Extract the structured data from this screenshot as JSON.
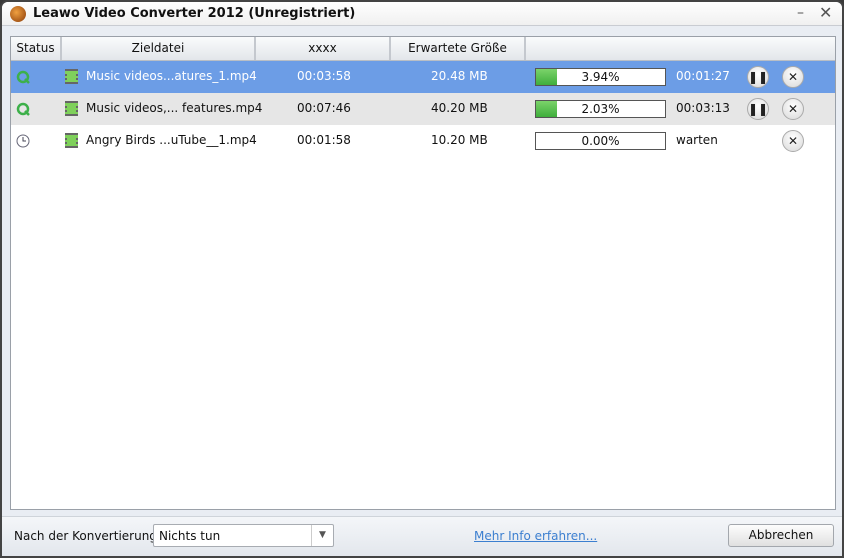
{
  "window": {
    "title": "Leawo Video Converter 2012 (Unregistriert)",
    "minimize": "–",
    "close": "✕"
  },
  "columns": [
    "Status",
    "Zieldatei",
    "xxxx",
    "Erwartete Größe",
    ""
  ],
  "rows": [
    {
      "status": "converting",
      "file": "Music videos...atures_1.mp4",
      "duration": "00:03:58",
      "size": "20.48 MB",
      "progress": 3.94,
      "progress_label": "3.94%",
      "remaining": "00:01:27",
      "pause": "❚❚",
      "cancel": "✕"
    },
    {
      "status": "converting",
      "file": "Music videos,... features.mp4",
      "duration": "00:07:46",
      "size": "40.20 MB",
      "progress": 2.03,
      "progress_label": "2.03%",
      "remaining": "00:03:13",
      "pause": "❚❚",
      "cancel": "✕"
    },
    {
      "status": "waiting",
      "file": "Angry Birds ...uTube__1.mp4",
      "duration": "00:01:58",
      "size": "10.20 MB",
      "progress": 0,
      "progress_label": "0.00%",
      "remaining": "warten",
      "cancel": "✕"
    }
  ],
  "footer": {
    "after_label": "Nach der Konvertierung:",
    "after_value": "Nichts tun",
    "more_info": "Mehr Info erfahren...",
    "cancel": "Abbrechen"
  },
  "colors": {
    "selected": "#6c9de6",
    "progress": "#4cbf45",
    "link": "#3c7fd0"
  }
}
